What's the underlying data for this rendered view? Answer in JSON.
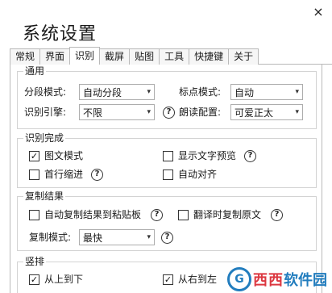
{
  "window": {
    "title": "系统设置",
    "close_glyph": "×"
  },
  "tabs": [
    {
      "label": "常规",
      "active": false
    },
    {
      "label": "界面",
      "active": false
    },
    {
      "label": "识别",
      "active": true
    },
    {
      "label": "截屏",
      "active": false
    },
    {
      "label": "贴图",
      "active": false
    },
    {
      "label": "工具",
      "active": false
    },
    {
      "label": "快捷键",
      "active": false
    },
    {
      "label": "关于",
      "active": false
    }
  ],
  "general": {
    "legend": "通用",
    "segment_mode_label": "分段模式:",
    "segment_mode_value": "自动分段",
    "punct_mode_label": "标点模式:",
    "punct_mode_value": "自动",
    "engine_label": "识别引擎:",
    "engine_value": "不限",
    "voice_label": "朗读配置:",
    "voice_value": "可爱正太",
    "help_glyph": "?"
  },
  "after_recognition": {
    "legend": "识别完成",
    "image_text_mode": {
      "label": "图文模式",
      "checked": true
    },
    "show_preview": {
      "label": "显示文字预览",
      "checked": false
    },
    "first_line_indent": {
      "label": "首行缩进",
      "checked": false
    },
    "auto_align": {
      "label": "自动对齐",
      "checked": false
    }
  },
  "copy_result": {
    "legend": "复制结果",
    "auto_copy": {
      "label": "自动复制结果到粘贴板",
      "checked": false
    },
    "translate_copy": {
      "label": "翻译时复制原文",
      "checked": false
    },
    "copy_mode_label": "复制模式:",
    "copy_mode_value": "最快"
  },
  "vertical": {
    "legend": "竖排",
    "top_to_bottom": {
      "label": "从上到下",
      "checked": true
    },
    "right_to_left": {
      "label": "从右到左",
      "checked": true
    }
  },
  "watermark": {
    "logo_text": "G",
    "brand_red": "西西",
    "brand_blue": "软件园"
  },
  "check_glyph": "✓",
  "arrow_glyph": "▾"
}
